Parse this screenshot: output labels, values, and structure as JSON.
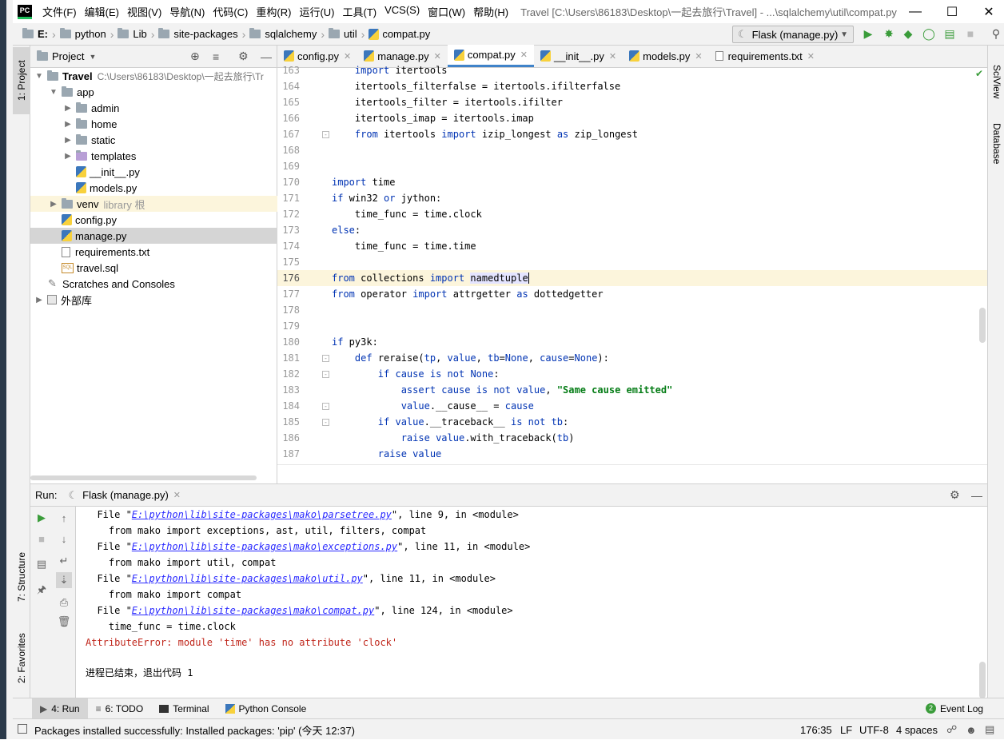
{
  "window": {
    "logo": "PC",
    "title": "Travel [C:\\Users\\86183\\Desktop\\一起去旅行\\Travel] - ...\\sqlalchemy\\util\\compat.py",
    "menu": [
      "文件(F)",
      "编辑(E)",
      "视图(V)",
      "导航(N)",
      "代码(C)",
      "重构(R)",
      "运行(U)",
      "工具(T)",
      "VCS(S)",
      "窗口(W)",
      "帮助(H)"
    ]
  },
  "breadcrumbs": [
    "E:",
    "python",
    "Lib",
    "site-packages",
    "sqlalchemy",
    "util",
    "compat.py"
  ],
  "run_config": "Flask (manage.py)",
  "left_strip": {
    "project": "1: Project",
    "structure": "7: Structure",
    "favorites": "2: Favorites"
  },
  "right_strip": {
    "sciview": "SciView",
    "database": "Database"
  },
  "project_panel": {
    "title": "Project",
    "tree": [
      {
        "label": "Travel",
        "extra": "C:\\Users\\86183\\Desktop\\一起去旅行\\Tr",
        "icon": "folder-icon"
      },
      {
        "label": "app",
        "extra": "",
        "icon": "folder-icon"
      },
      {
        "label": "admin",
        "extra": "",
        "icon": "folder-icon"
      },
      {
        "label": "home",
        "extra": "",
        "icon": "folder-icon"
      },
      {
        "label": "static",
        "extra": "",
        "icon": "folder-icon"
      },
      {
        "label": "templates",
        "extra": "",
        "icon": "folder-icon"
      },
      {
        "label": "__init__.py",
        "extra": "",
        "icon": "python-file-icon"
      },
      {
        "label": "models.py",
        "extra": "",
        "icon": "python-file-icon"
      },
      {
        "label": "venv",
        "extra": "library 根",
        "icon": "folder-icon"
      },
      {
        "label": "config.py",
        "extra": "",
        "icon": "python-file-icon"
      },
      {
        "label": "manage.py",
        "extra": "",
        "icon": "python-file-icon"
      },
      {
        "label": "requirements.txt",
        "extra": "",
        "icon": "text-file-icon"
      },
      {
        "label": "travel.sql",
        "extra": "",
        "icon": "sql-file-icon"
      },
      {
        "label": "Scratches and Consoles",
        "extra": "",
        "icon": "scratches-icon"
      },
      {
        "label": "外部库",
        "extra": "",
        "icon": "library-icon"
      }
    ]
  },
  "editor_tabs": [
    "config.py",
    "manage.py",
    "compat.py",
    "__init__.py",
    "models.py",
    "requirements.txt"
  ],
  "code": [
    {
      "n": "163",
      "t": "    import itertools"
    },
    {
      "n": "164",
      "t": "    itertools_filterfalse = itertools.ifilterfalse"
    },
    {
      "n": "165",
      "t": "    itertools_filter = itertools.ifilter"
    },
    {
      "n": "166",
      "t": "    itertools_imap = itertools.imap"
    },
    {
      "n": "167",
      "t": "    from itertools import izip_longest as zip_longest"
    },
    {
      "n": "168",
      "t": ""
    },
    {
      "n": "169",
      "t": ""
    },
    {
      "n": "170",
      "t": "import time"
    },
    {
      "n": "171",
      "t": "if win32 or jython:"
    },
    {
      "n": "172",
      "t": "    time_func = time.clock"
    },
    {
      "n": "173",
      "t": "else:"
    },
    {
      "n": "174",
      "t": "    time_func = time.time"
    },
    {
      "n": "175",
      "t": ""
    },
    {
      "n": "176",
      "t": "from collections import namedtuple"
    },
    {
      "n": "177",
      "t": "from operator import attrgetter as dottedgetter"
    },
    {
      "n": "178",
      "t": ""
    },
    {
      "n": "179",
      "t": ""
    },
    {
      "n": "180",
      "t": "if py3k:"
    },
    {
      "n": "181",
      "t": "    def reraise(tp, value, tb=None, cause=None):"
    },
    {
      "n": "182",
      "t": "        if cause is not None:"
    },
    {
      "n": "183",
      "t": "            assert cause is not value, \"Same cause emitted\""
    },
    {
      "n": "184",
      "t": "            value.__cause__ = cause"
    },
    {
      "n": "185",
      "t": "        if value.__traceback__ is not tb:"
    },
    {
      "n": "186",
      "t": "            raise value.with_traceback(tb)"
    },
    {
      "n": "187",
      "t": "        raise value"
    }
  ],
  "run_panel": {
    "label": "Run:",
    "tab": "Flask (manage.py)",
    "output": [
      {
        "pre": "  File \"",
        "link": "E:\\python\\lib\\site-packages\\mako\\parsetree.py",
        "post": "\", line 9, in <module>"
      },
      {
        "pre": "    from mako import exceptions, ast, util, filters, compat",
        "link": "",
        "post": ""
      },
      {
        "pre": "  File \"",
        "link": "E:\\python\\lib\\site-packages\\mako\\exceptions.py",
        "post": "\", line 11, in <module>"
      },
      {
        "pre": "    from mako import util, compat",
        "link": "",
        "post": ""
      },
      {
        "pre": "  File \"",
        "link": "E:\\python\\lib\\site-packages\\mako\\util.py",
        "post": "\", line 11, in <module>"
      },
      {
        "pre": "    from mako import compat",
        "link": "",
        "post": ""
      },
      {
        "pre": "  File \"",
        "link": "E:\\python\\lib\\site-packages\\mako\\compat.py",
        "post": "\", line 124, in <module>"
      },
      {
        "pre": "    time_func = time.clock",
        "link": "",
        "post": ""
      }
    ],
    "error": "AttributeError: module 'time' has no attribute 'clock'",
    "exit": "进程已结束，退出代码 1"
  },
  "bottom_tabs": {
    "run": "4: Run",
    "todo": "6: TODO",
    "terminal": "Terminal",
    "python_console": "Python Console",
    "event_log": "Event Log",
    "event_count": "2"
  },
  "status": {
    "message": "Packages installed successfully: Installed packages: 'pip' (今天 12:37)",
    "position": "176:35",
    "line_sep": "LF",
    "encoding": "UTF-8",
    "indent": "4 spaces"
  },
  "colors": {
    "keyword": "#0033b3",
    "string": "#067d17",
    "link": "#2a2aff",
    "error": "#c0271c",
    "caret_line": "#fcf5dc",
    "selection": "#d5d5d5"
  }
}
